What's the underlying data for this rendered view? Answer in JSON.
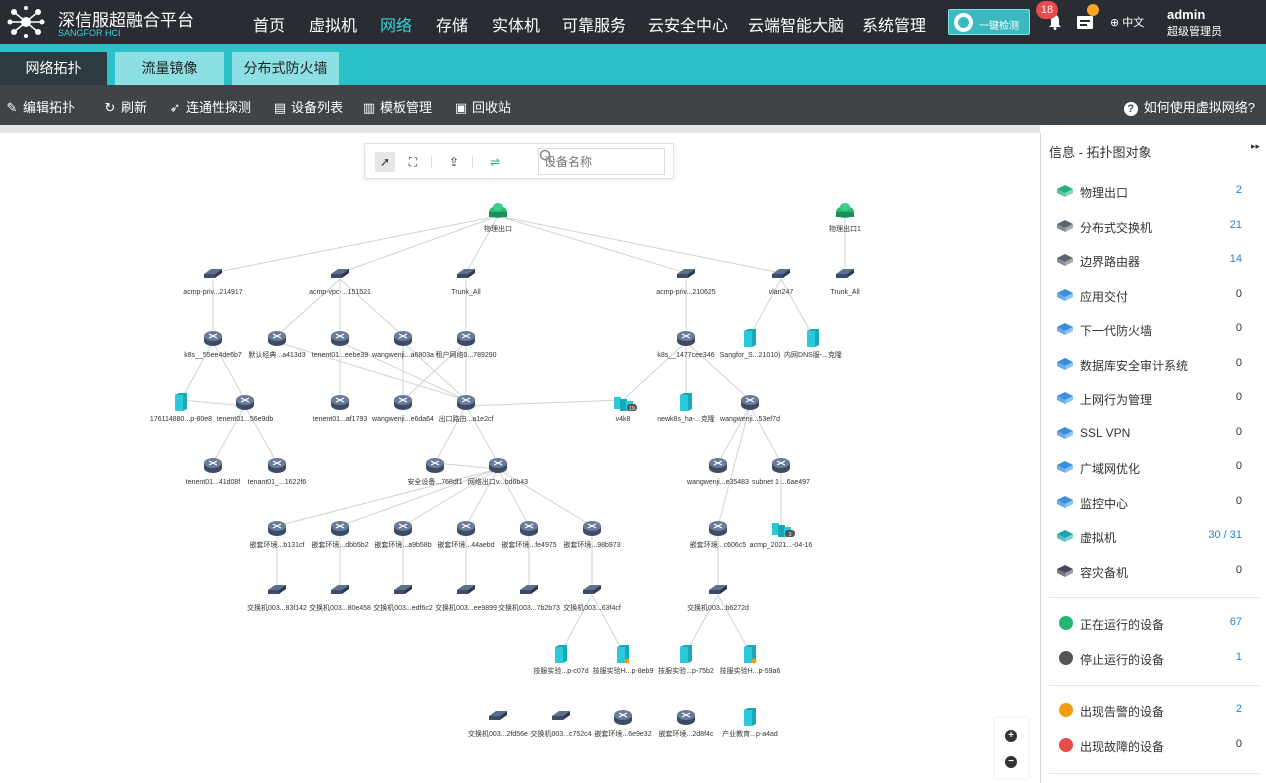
{
  "brand": {
    "title": "深信服超融合平台",
    "subtitle": "SANGFOR HCI"
  },
  "nav": [
    "首页",
    "虚拟机",
    "网络",
    "存储",
    "实体机",
    "可靠服务",
    "云安全中心",
    "云端智能大脑",
    "系统管理"
  ],
  "nav_active": "网络",
  "header": {
    "check_label": "一键检测",
    "alert_count": "18",
    "lang": "中文",
    "user": "admin",
    "role": "超级管理员"
  },
  "tabs": [
    "网络拓扑",
    "流量镜像",
    "分布式防火墙"
  ],
  "toolbar": {
    "edit": "编辑拓扑",
    "refresh": "刷新",
    "probe": "连通性探测",
    "device_list": "设备列表",
    "template": "模板管理",
    "recycle": "回收站",
    "help": "如何使用虚拟网络?"
  },
  "canvas_toolbar": {
    "search_placeholder": "设备名称"
  },
  "panel": {
    "title": "信息 - 拓扑图对象",
    "objects": [
      {
        "label": "物理出口",
        "count": "2",
        "icon": "physical-exit-icon",
        "highlight": true
      },
      {
        "label": "分布式交换机",
        "count": "21",
        "icon": "distributed-switch-icon",
        "highlight": true
      },
      {
        "label": "边界路由器",
        "count": "14",
        "icon": "edge-router-icon",
        "highlight": true
      },
      {
        "label": "应用交付",
        "count": "0",
        "icon": "app-delivery-icon",
        "highlight": false
      },
      {
        "label": "下一代防火墙",
        "count": "0",
        "icon": "ngfw-icon",
        "highlight": false
      },
      {
        "label": "数据库安全审计系统",
        "count": "0",
        "icon": "db-audit-icon",
        "highlight": false
      },
      {
        "label": "上网行为管理",
        "count": "0",
        "icon": "behavior-mgmt-icon",
        "highlight": false
      },
      {
        "label": "SSL VPN",
        "count": "0",
        "icon": "ssl-vpn-icon",
        "highlight": false
      },
      {
        "label": "广域网优化",
        "count": "0",
        "icon": "wan-opt-icon",
        "highlight": false
      },
      {
        "label": "监控中心",
        "count": "0",
        "icon": "monitor-center-icon",
        "highlight": false
      },
      {
        "label": "虚拟机",
        "count": "30 / 31",
        "icon": "vm-icon",
        "highlight": true
      },
      {
        "label": "容灾备机",
        "count": "0",
        "icon": "dr-backup-icon",
        "highlight": false
      }
    ],
    "status": [
      {
        "label": "正在运行的设备",
        "count": "67",
        "color": "#22b573",
        "icon": "running-icon",
        "highlight": true
      },
      {
        "label": "停止运行的设备",
        "count": "1",
        "color": "#555555",
        "icon": "stopped-icon",
        "highlight": true
      }
    ],
    "alerts": [
      {
        "label": "出现告警的设备",
        "count": "2",
        "color": "#f39c12",
        "icon": "warning-icon",
        "highlight": true
      },
      {
        "label": "出现故障的设备",
        "count": "0",
        "color": "#e84b4b",
        "icon": "fault-icon",
        "highlight": false
      }
    ]
  },
  "topology": {
    "nodes": [
      {
        "id": "e1",
        "type": "exit",
        "label": "物理出口"
      },
      {
        "id": "e2",
        "type": "exit",
        "label": "物理出口1"
      },
      {
        "id": "s1",
        "type": "switch",
        "label": "acmp-priv...214917"
      },
      {
        "id": "s2",
        "type": "switch",
        "label": "acmp-vpc-...151521"
      },
      {
        "id": "s3",
        "type": "switch",
        "label": "Trunk_All"
      },
      {
        "id": "s4",
        "type": "switch",
        "label": "acmp-priv...210625"
      },
      {
        "id": "s5",
        "type": "switch",
        "label": "vlan247"
      },
      {
        "id": "s6",
        "type": "switch",
        "label": "Trunk_All"
      },
      {
        "id": "r1",
        "type": "router",
        "label": "k8s__55ee4de6b7"
      },
      {
        "id": "r2",
        "type": "router",
        "label": "默认经典...a413d3"
      },
      {
        "id": "r3",
        "type": "router",
        "label": "tenent01...eebe39"
      },
      {
        "id": "r4",
        "type": "router",
        "label": "wangwenji...a6803a"
      },
      {
        "id": "r5",
        "type": "router",
        "label": "租户网络0...789290"
      },
      {
        "id": "r6",
        "type": "router",
        "label": "k8s__1477cee346"
      },
      {
        "id": "v1",
        "type": "vm",
        "label": "Sangfor_S...21010)"
      },
      {
        "id": "v2",
        "type": "vm",
        "label": "内网DNS服-...克隆"
      },
      {
        "id": "v3",
        "type": "vm",
        "label": "176114880...p-80e8"
      },
      {
        "id": "r7",
        "type": "router",
        "label": "tenent01...56e9db"
      },
      {
        "id": "r8",
        "type": "router",
        "label": "tenent01...af1793"
      },
      {
        "id": "r9",
        "type": "router",
        "label": "wangwenji...e6da64"
      },
      {
        "id": "r10",
        "type": "router",
        "label": "出口路由...a1e2cf"
      },
      {
        "id": "v4",
        "type": "vmgroup",
        "label": "v4k8",
        "badge": "19"
      },
      {
        "id": "v5",
        "type": "vm",
        "label": "newk8s_ha-...克隆"
      },
      {
        "id": "r11",
        "type": "router",
        "label": "wangwenji...53ef7d"
      },
      {
        "id": "r12",
        "type": "router",
        "label": "tenent01...41d08f"
      },
      {
        "id": "r13",
        "type": "router",
        "label": "tenant01_...1622f6"
      },
      {
        "id": "r14",
        "type": "router",
        "label": "安全设备...768df1"
      },
      {
        "id": "r15",
        "type": "router",
        "label": "网络出口v...bd6b43"
      },
      {
        "id": "r16",
        "type": "router",
        "label": "wangwenji...e35483"
      },
      {
        "id": "r17",
        "type": "router",
        "label": "subnet 1 ...6ae497"
      },
      {
        "id": "n1",
        "type": "router",
        "label": "嵌套环境...b131cf"
      },
      {
        "id": "n2",
        "type": "router",
        "label": "嵌套环境...dbb5b2"
      },
      {
        "id": "n3",
        "type": "router",
        "label": "嵌套环境...a9b58b"
      },
      {
        "id": "n4",
        "type": "router",
        "label": "嵌套环境...44aebd"
      },
      {
        "id": "n5",
        "type": "router",
        "label": "嵌套环境...fe4975"
      },
      {
        "id": "n6",
        "type": "router",
        "label": "嵌套环境...98b973"
      },
      {
        "id": "n7",
        "type": "router",
        "label": "嵌套环境...c606c5"
      },
      {
        "id": "v6",
        "type": "vmgroup",
        "label": "acmp_2021...-04-16",
        "badge": "3"
      },
      {
        "id": "w1",
        "type": "switch",
        "label": "交换机003...83f142"
      },
      {
        "id": "w2",
        "type": "switch",
        "label": "交换机003...80e458"
      },
      {
        "id": "w3",
        "type": "switch",
        "label": "交换机003...edf6c2"
      },
      {
        "id": "w4",
        "type": "switch",
        "label": "交换机003...ee9899"
      },
      {
        "id": "w5",
        "type": "switch",
        "label": "交换机003...7b2b73"
      },
      {
        "id": "w6",
        "type": "switch",
        "label": "交换机003...63f4cf"
      },
      {
        "id": "w7",
        "type": "switch",
        "label": "交换机003...b6272d"
      },
      {
        "id": "v7",
        "type": "vm",
        "label": "技服实验...p-c07d"
      },
      {
        "id": "v8",
        "type": "vm",
        "label": "技服实验H...p-8eb9",
        "warn": true
      },
      {
        "id": "v9",
        "type": "vm",
        "label": "技服实验...p-75b2"
      },
      {
        "id": "v10",
        "type": "vm",
        "label": "技服实验H...p-59a6",
        "warn": true
      },
      {
        "id": "i1",
        "type": "switch",
        "label": "交换机003...2fd56e"
      },
      {
        "id": "i2",
        "type": "switch",
        "label": "交换机003...c752c4"
      },
      {
        "id": "i3",
        "type": "router",
        "label": "嵌套环境...6e9e32"
      },
      {
        "id": "i4",
        "type": "router",
        "label": "嵌套环境...2d8f4c"
      },
      {
        "id": "i5",
        "type": "vm",
        "label": "产业教育...p-a4ad"
      }
    ],
    "links": [
      [
        "e1",
        "s1"
      ],
      [
        "e1",
        "s2"
      ],
      [
        "e1",
        "s3"
      ],
      [
        "e1",
        "s4"
      ],
      [
        "e1",
        "s5"
      ],
      [
        "e2",
        "s6"
      ],
      [
        "s1",
        "r1"
      ],
      [
        "s2",
        "r2"
      ],
      [
        "s2",
        "r3"
      ],
      [
        "s2",
        "r4"
      ],
      [
        "s3",
        "r5"
      ],
      [
        "s4",
        "r6"
      ],
      [
        "s5",
        "v1"
      ],
      [
        "s5",
        "v2"
      ],
      [
        "r1",
        "v3"
      ],
      [
        "r1",
        "r7"
      ],
      [
        "r2",
        "r10"
      ],
      [
        "r3",
        "r8"
      ],
      [
        "r3",
        "r10"
      ],
      [
        "r4",
        "r9"
      ],
      [
        "r4",
        "r10"
      ],
      [
        "r5",
        "r10"
      ],
      [
        "r5",
        "r9"
      ],
      [
        "r6",
        "v4"
      ],
      [
        "r6",
        "v5"
      ],
      [
        "r6",
        "r11"
      ],
      [
        "r10",
        "v4"
      ],
      [
        "r10",
        "r15"
      ],
      [
        "r10",
        "r14"
      ],
      [
        "r7",
        "r12"
      ],
      [
        "r7",
        "r13"
      ],
      [
        "r7",
        "v3"
      ],
      [
        "r15",
        "n1"
      ],
      [
        "r15",
        "n2"
      ],
      [
        "r15",
        "n3"
      ],
      [
        "r15",
        "n4"
      ],
      [
        "r15",
        "n5"
      ],
      [
        "r15",
        "n6"
      ],
      [
        "r15",
        "r14"
      ],
      [
        "r11",
        "r16"
      ],
      [
        "r11",
        "r17"
      ],
      [
        "r11",
        "n7"
      ],
      [
        "r17",
        "v6"
      ],
      [
        "n1",
        "w1"
      ],
      [
        "n2",
        "w2"
      ],
      [
        "n3",
        "w3"
      ],
      [
        "n4",
        "w4"
      ],
      [
        "n5",
        "w5"
      ],
      [
        "n6",
        "w6"
      ],
      [
        "n7",
        "w7"
      ],
      [
        "w6",
        "v7"
      ],
      [
        "w6",
        "v8"
      ],
      [
        "w7",
        "v9"
      ],
      [
        "w7",
        "v10"
      ]
    ]
  }
}
